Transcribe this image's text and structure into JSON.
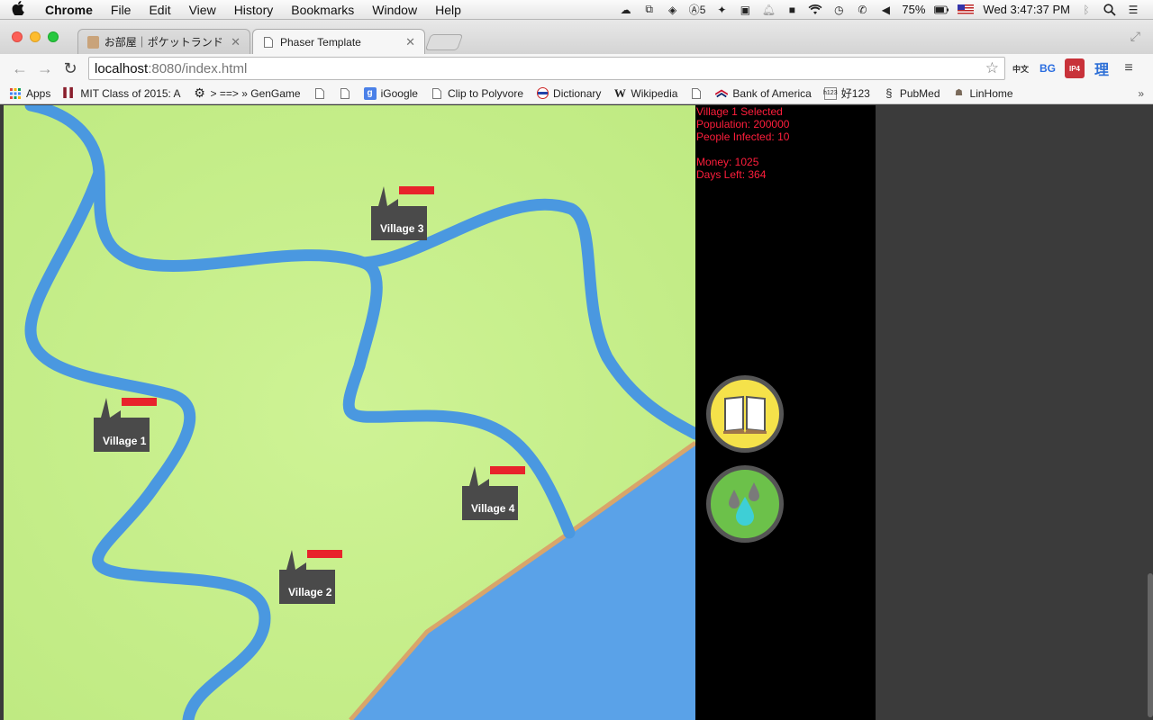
{
  "menubar": {
    "app_name": "Chrome",
    "items": [
      "File",
      "Edit",
      "View",
      "History",
      "Bookmarks",
      "Window",
      "Help"
    ],
    "battery": "75%",
    "clock": "Wed 3:47:37 PM",
    "adobe_count": "5"
  },
  "tabs": [
    {
      "title": "お部屋｜ポケットランド by",
      "active": false
    },
    {
      "title": "Phaser Template",
      "active": true
    }
  ],
  "toolbar": {
    "url_host": "localhost",
    "url_rest": ":8080/index.html"
  },
  "extensions": [
    "中文",
    "BG",
    "IP4",
    "理"
  ],
  "bookmarks": [
    {
      "label": "Apps",
      "icon": "apps-grid-icon"
    },
    {
      "label": "MIT Class of 2015: A",
      "icon": "mit-icon"
    },
    {
      "label": "> ==> » GenGame",
      "icon": "gear-icon"
    },
    {
      "label": "",
      "icon": "page-icon"
    },
    {
      "label": "",
      "icon": "page-icon"
    },
    {
      "label": "iGoogle",
      "icon": "google-icon"
    },
    {
      "label": "Clip to Polyvore",
      "icon": "page-icon"
    },
    {
      "label": "Dictionary",
      "icon": "dictionary-icon"
    },
    {
      "label": "Wikipedia",
      "icon": "wikipedia-icon"
    },
    {
      "label": "",
      "icon": "page-icon"
    },
    {
      "label": "Bank of America",
      "icon": "boa-icon"
    },
    {
      "label": "好123",
      "icon": "hao123-icon"
    },
    {
      "label": "PubMed",
      "icon": "pubmed-icon"
    },
    {
      "label": "LinHome",
      "icon": "linhome-icon"
    }
  ],
  "game": {
    "info": {
      "selected": "Village 1 Selected",
      "population": "Population: 200000",
      "infected": "People Infected: 10",
      "money": "Money: 1025",
      "days_left": "Days Left: 364"
    },
    "villages": [
      {
        "name": "Village 1",
        "health": 1.0
      },
      {
        "name": "Village 2",
        "health": 1.0
      },
      {
        "name": "Village 3",
        "health": 1.0
      },
      {
        "name": "Village 4",
        "health": 1.0
      }
    ],
    "buttons": [
      {
        "name": "book-button",
        "icon": "book-icon",
        "color": "#f5e24a"
      },
      {
        "name": "water-button",
        "icon": "water-drops-icon",
        "color": "#6cc14a"
      }
    ],
    "colors": {
      "land": "#c9f08f",
      "river": "#4a98e0",
      "sea": "#5aa2e8",
      "shore": "#d9a56a",
      "info_text": "#ff1e3c",
      "health_bar": "#e8232b",
      "village": "#4a4a4a"
    }
  }
}
